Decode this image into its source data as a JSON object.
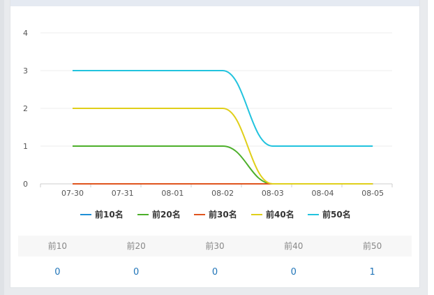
{
  "chart_data": {
    "type": "line",
    "categories": [
      "07-30",
      "07-31",
      "08-01",
      "08-02",
      "08-03",
      "08-04",
      "08-05"
    ],
    "y_ticks": [
      "0",
      "1",
      "2",
      "3",
      "4"
    ],
    "ylim": [
      0,
      4
    ],
    "grid": true,
    "legend_position": "bottom",
    "series": [
      {
        "name": "前10名",
        "color": "#1f8fd6",
        "values": [
          0,
          0,
          0,
          0,
          0,
          0,
          0
        ]
      },
      {
        "name": "前20名",
        "color": "#4caf2a",
        "values": [
          1,
          1,
          1,
          1,
          0,
          0,
          0
        ]
      },
      {
        "name": "前30名",
        "color": "#e0541e",
        "values": [
          0,
          0,
          0,
          0,
          0,
          0,
          0
        ]
      },
      {
        "name": "前40名",
        "color": "#e0cf1a",
        "values": [
          2,
          2,
          2,
          2,
          0,
          0,
          0
        ]
      },
      {
        "name": "前50名",
        "color": "#22c3de",
        "values": [
          3,
          3,
          3,
          3,
          1,
          1,
          1
        ]
      }
    ]
  },
  "stats": {
    "headers": [
      "前10",
      "前20",
      "前30",
      "前40",
      "前50"
    ],
    "values": [
      "0",
      "0",
      "0",
      "0",
      "1"
    ]
  }
}
